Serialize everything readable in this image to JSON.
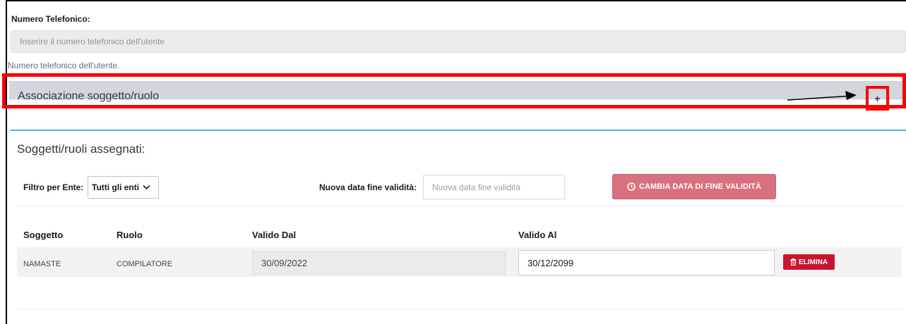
{
  "phone": {
    "label": "Numero Telefonico:",
    "placeholder": "Inserire il numero telefonico dell'utente",
    "help": "Numero telefonico dell'utente."
  },
  "association": {
    "title": "Associazione soggetto/ruolo",
    "expand_icon": "+"
  },
  "assigned": {
    "title": "Soggetti/ruoli assegnati:",
    "filter_label": "Filtro per Ente:",
    "filter_value": "Tutti gli enti",
    "new_date_label": "Nuova data fine validità:",
    "new_date_placeholder": "Nuova data fine validità",
    "change_button": "CAMBIA DATA DI FINE VALIDITÀ",
    "columns": [
      "Soggetto",
      "Ruolo",
      "Valido Dal",
      "Valido Al"
    ],
    "rows": [
      {
        "subject": "NAMASTE",
        "role": "COMPILATORE",
        "valid_from": "30/09/2022",
        "valid_to": "30/12/2099",
        "delete_label": "ELIMINA"
      }
    ]
  },
  "colors": {
    "highlight": "#ff0000",
    "accent_line": "#3fb5e8",
    "change_button": "#d9707f",
    "delete_button": "#c9142e"
  }
}
